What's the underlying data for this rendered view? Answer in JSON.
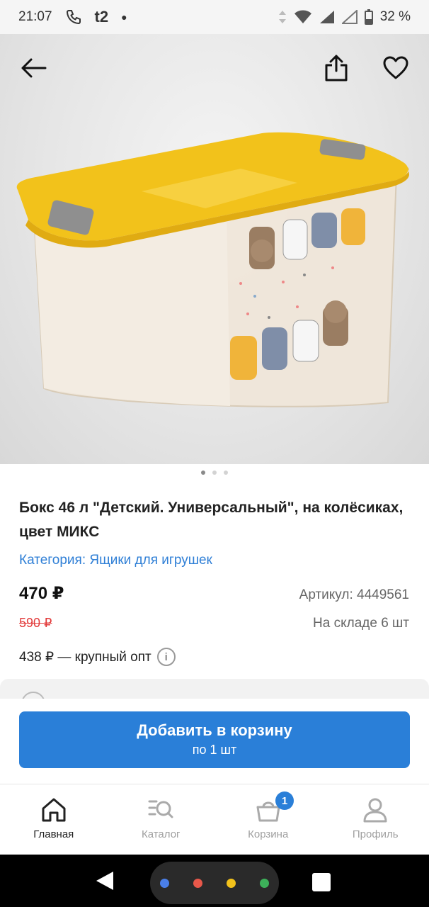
{
  "status_bar": {
    "time": "21:07",
    "carrier": "t2",
    "battery": "32 %"
  },
  "product": {
    "title": "Бокс 46 л \"Детский. Универсальный\", на колёсиках, цвет МИКС",
    "category_label": "Категория:",
    "category_value": "Ящики для игрушек",
    "price": "470 ₽",
    "old_price": "590 ₽",
    "article": "Артикул: 4449561",
    "stock": "На складе 6 шт",
    "wholesale": "438 ₽ — крупный опт",
    "image_pages_total": 3,
    "image_page_current": 1
  },
  "cart_button": {
    "label": "Добавить в корзину",
    "sub_label": "по 1 шт"
  },
  "tabbar": {
    "items": [
      {
        "label": "Главная",
        "icon": "home-icon",
        "active": true
      },
      {
        "label": "Каталог",
        "icon": "catalog-search-icon",
        "active": false
      },
      {
        "label": "Корзина",
        "icon": "basket-icon",
        "active": false,
        "badge": "1"
      },
      {
        "label": "Профиль",
        "icon": "user-icon",
        "active": false
      }
    ]
  },
  "colors": {
    "accent": "#2a7fd8",
    "old_price": "#e23b3b",
    "link": "#2f7fd6",
    "lid_yellow": "#f2c21b"
  }
}
